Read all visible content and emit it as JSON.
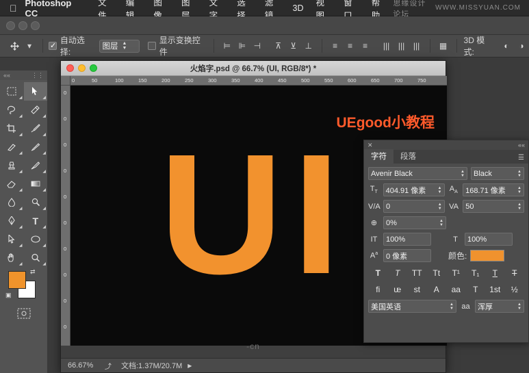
{
  "menubar": {
    "apple_icon": "apple-icon",
    "app_name": "Photoshop CC",
    "items": [
      "文件",
      "编辑",
      "图像",
      "图层",
      "文字",
      "选择",
      "滤镜",
      "3D",
      "视图",
      "窗口",
      "帮助"
    ],
    "watermark_right": "思缘设计论坛",
    "watermark_right2": "WWW.MISSYUAN.COM"
  },
  "options_bar": {
    "move_tool_icon": "move-tool-icon",
    "auto_select_label": "自动选择:",
    "auto_select_value": "图层",
    "show_transform_label": "显示变换控件",
    "mode_3d_label": "3D 模式:"
  },
  "tool_panel": {
    "collapse_icon": "collapse-icon",
    "tools": [
      [
        "marquee-tool",
        "move-tool"
      ],
      [
        "lasso-tool",
        "magic-wand-tool"
      ],
      [
        "crop-tool",
        "eyedropper-tool"
      ],
      [
        "healing-brush-tool",
        "brush-tool"
      ],
      [
        "clone-stamp-tool",
        "history-brush-tool"
      ],
      [
        "eraser-tool",
        "gradient-tool"
      ],
      [
        "blur-tool",
        "dodge-tool"
      ],
      [
        "pen-tool",
        "type-tool"
      ],
      [
        "path-selection-tool",
        "ellipse-shape-tool"
      ],
      [
        "hand-tool",
        "zoom-tool"
      ]
    ],
    "foreground_color": "#f0932b",
    "background_color": "#ffffff",
    "quickmask_icon": "quick-mask-icon"
  },
  "document": {
    "title": "火焰字.psd @ 66.7% (UI, RGB/8*) *",
    "ruler_h_ticks": [
      "0",
      "50",
      "100",
      "150",
      "200",
      "250",
      "300",
      "350",
      "400",
      "450",
      "500",
      "550",
      "600",
      "650",
      "700",
      "750"
    ],
    "ruler_v_ticks": [
      "0",
      "0",
      "0",
      "0",
      "0",
      "0",
      "0",
      "0",
      "0",
      "0"
    ],
    "canvas_watermark": "UEgood小教程",
    "canvas_text": "UI",
    "canvas_text_color": "#f2922e",
    "canvas_background": "#0a0a0a",
    "cn_mark": "-cn",
    "status": {
      "zoom": "66.67%",
      "share_icon": "share-icon",
      "doc_info": "文档:1.37M/20.7M",
      "play_icon": "play-icon"
    }
  },
  "character_panel": {
    "close_icon": "close-icon",
    "collapse_icon": "collapse-icon",
    "tabs": [
      {
        "label": "字符",
        "active": true
      },
      {
        "label": "段落",
        "active": false
      }
    ],
    "menu_icon": "panel-menu-icon",
    "font_family": "Avenir Black",
    "font_style": "Black",
    "size_icon": "font-size-icon",
    "font_size": "404.91 像素",
    "leading_icon": "leading-icon",
    "leading": "168.71 像素",
    "kerning_icon": "kerning-icon",
    "kerning": "0",
    "tracking_icon": "tracking-icon",
    "tracking": "50",
    "vscale_icon": "vertical-scale-icon",
    "scale_extra": "0%",
    "vertical_scale": "100%",
    "horizontal_scale": "100%",
    "baseline_icon": "baseline-shift-icon",
    "baseline_shift": "0 像素",
    "color_label": "颜色:",
    "color_value": "#f0922e",
    "style_buttons_row1": [
      "T",
      "T",
      "TT",
      "Tt",
      "T¹",
      "T₁",
      "T",
      "T"
    ],
    "style_buttons_row2": [
      "fi",
      "ᵫ",
      "st",
      "A",
      "aa",
      "T",
      "1st",
      "½"
    ],
    "language": "美国英语",
    "antialias_icon": "anti-alias-icon",
    "antialias": "浑厚"
  }
}
